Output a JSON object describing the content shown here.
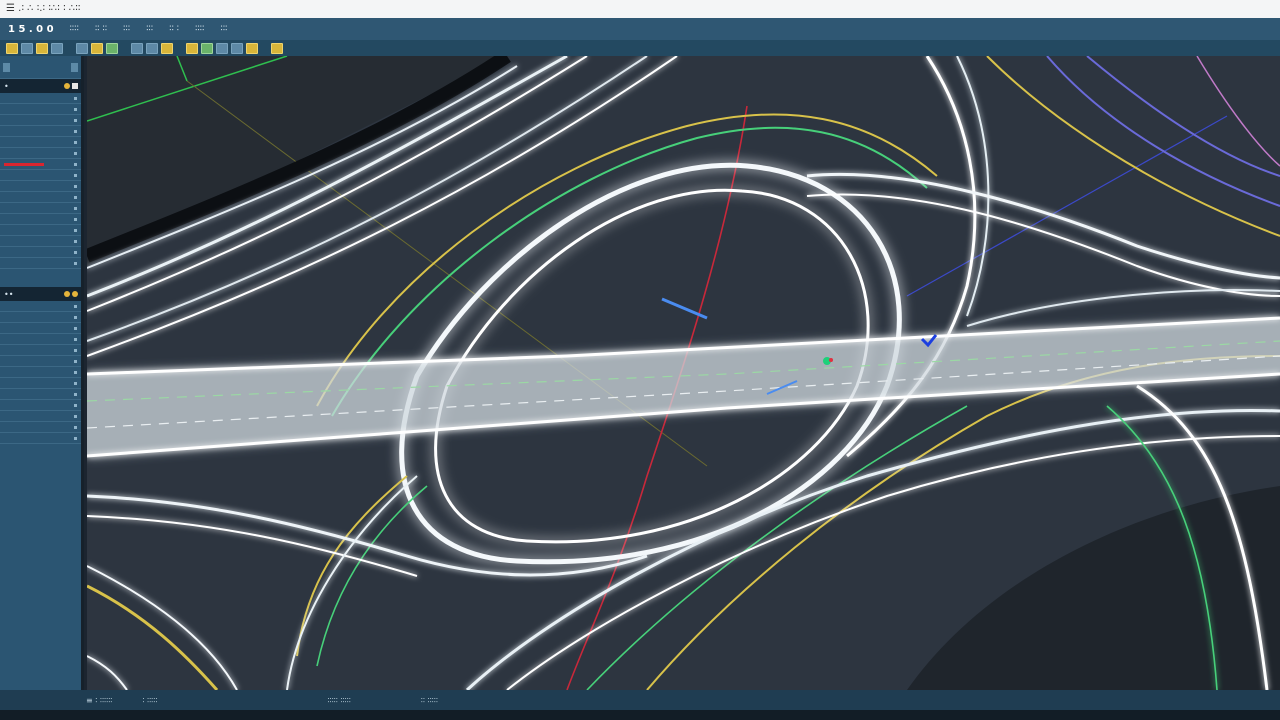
{
  "window": {
    "title": "☰ .∶ ∴ ∶.∶ ∶∴∶ ∶ ∴∶∶"
  },
  "menubar": {
    "logo": "1 5 . 0 0",
    "items": [
      "∶∶∶∶",
      "∶∶ ∶∶",
      "∶∶∶",
      "∶∶∶",
      "∶∶ ∶",
      "∶∶∶∶",
      "∶∶∶"
    ]
  },
  "left_panel": {
    "section1_rows": 16,
    "section2_rows": 13
  },
  "viewport": {
    "description": "3D road interchange wireframe",
    "colors": {
      "background": "#2a313a",
      "road_glow": "#ffffff",
      "lane_yellow": "#d8c24a",
      "lane_green": "#47d07a",
      "lane_blue": "#6a6ad8",
      "axis_red": "#c8283a",
      "axis_green": "#2fbf4f"
    }
  },
  "status": {
    "items": [
      "≡ ∶ ∶∶∶∶∶∶",
      "∶ ∶∶∶∶∶",
      "∶∶∶∶∶ ∶∶∶∶∶",
      "∶∶ ∶∶∶∶∶"
    ]
  }
}
